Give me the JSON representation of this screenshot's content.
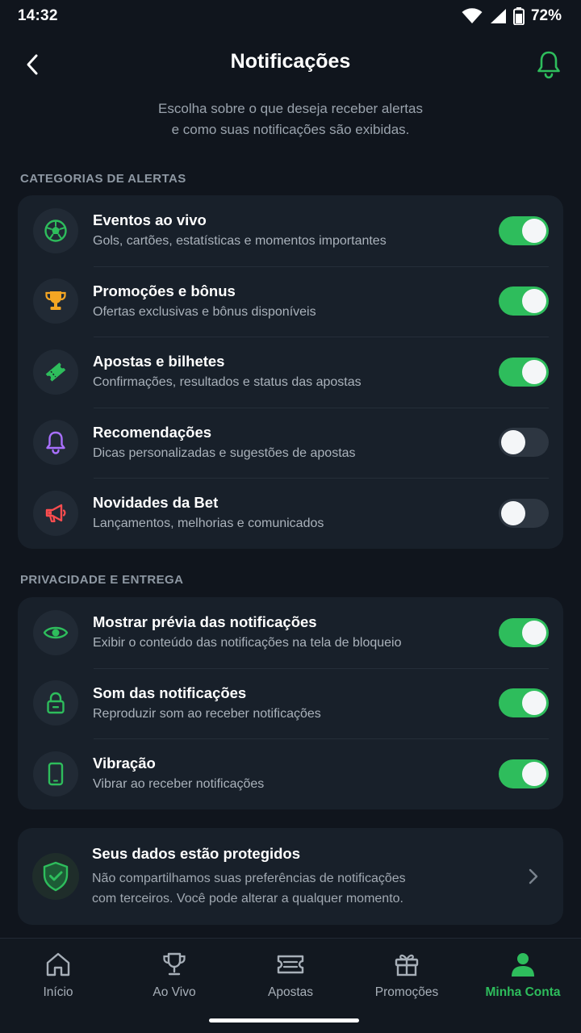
{
  "status": {
    "time": "14:32",
    "battery": "72%"
  },
  "header": {
    "title": "Notificações",
    "subtitle_line1": "Escolha sobre o que deseja receber alertas",
    "subtitle_line2": "e como suas notificações são exibidas."
  },
  "sections": {
    "alerts": {
      "label": "CATEGORIAS DE ALERTAS",
      "items": [
        {
          "title": "Eventos ao vivo",
          "desc": "Gols, cartões, estatísticas e momentos importantes",
          "icon": "soccer-ball-icon",
          "color": "#2ebd5c",
          "enabled": true
        },
        {
          "title": "Promoções e bônus",
          "desc": "Ofertas exclusivas e bônus disponíveis",
          "icon": "trophy-icon",
          "color": "#f5a623",
          "enabled": true
        },
        {
          "title": "Apostas e bilhetes",
          "desc": "Confirmações, resultados e status das apostas",
          "icon": "ticket-icon",
          "color": "#2ebd5c",
          "enabled": true
        },
        {
          "title": "Recomendações",
          "desc": "Dicas personalizadas e sugestões de apostas",
          "icon": "bell-icon",
          "color": "#a970ff",
          "enabled": false
        },
        {
          "title": "Novidades da Bet",
          "desc": "Lançamentos, melhorias e comunicados",
          "icon": "megaphone-icon",
          "color": "#ff4d4f",
          "enabled": false
        }
      ]
    },
    "privacy": {
      "label": "PRIVACIDADE E ENTREGA",
      "items": [
        {
          "title": "Mostrar prévia das notificações",
          "desc": "Exibir o conteúdo das notificações na tela de bloqueio",
          "icon": "eye-icon",
          "color": "#2ebd5c",
          "enabled": true
        },
        {
          "title": "Som das notificações",
          "desc": "Reproduzir som ao receber notificações",
          "icon": "lock-icon",
          "color": "#2ebd5c",
          "enabled": true
        },
        {
          "title": "Vibração",
          "desc": "Vibrar ao receber notificações",
          "icon": "phone-icon",
          "color": "#2ebd5c",
          "enabled": true
        }
      ]
    }
  },
  "protection": {
    "title": "Seus dados estão protegidos",
    "desc_line1": "Não compartilhamos suas preferências de notificações",
    "desc_line2": "com terceiros. Você pode alterar a qualquer momento."
  },
  "nav": {
    "items": [
      {
        "label": "Início",
        "icon": "home-icon"
      },
      {
        "label": "Ao Vivo",
        "icon": "trophy-icon"
      },
      {
        "label": "Apostas",
        "icon": "ticket-icon"
      },
      {
        "label": "Promoções",
        "icon": "gift-icon"
      },
      {
        "label": "Minha Conta",
        "icon": "user-icon"
      }
    ],
    "active": "Minha Conta"
  },
  "colors": {
    "accent": "#2ebd5c",
    "background": "#10151d",
    "card": "#18202a"
  }
}
